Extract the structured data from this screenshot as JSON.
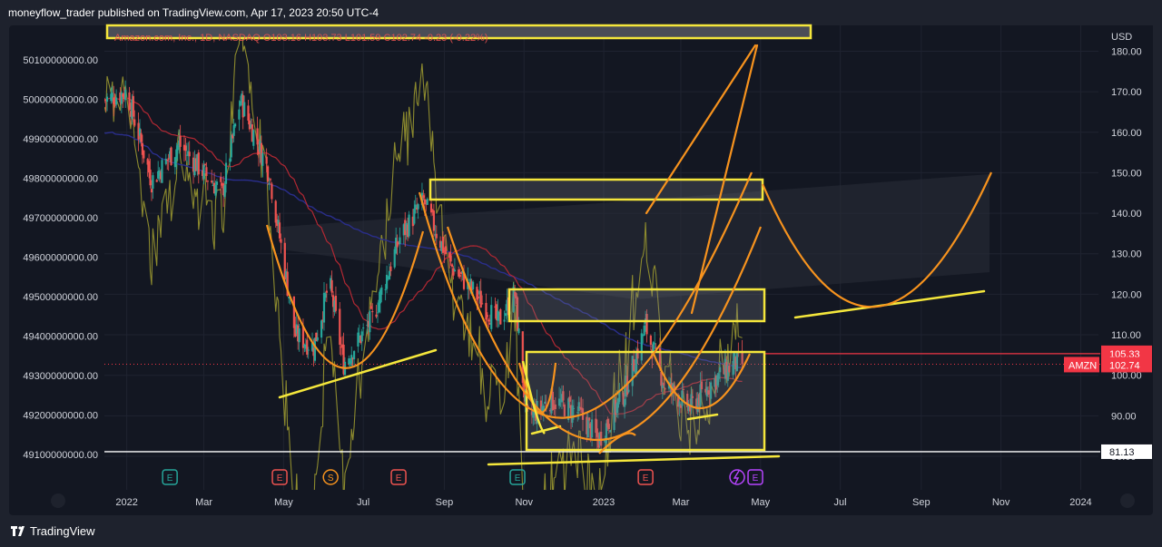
{
  "header": {
    "published": "moneyflow_trader published on TradingView.com, Apr 17, 2023 20:50 UTC-4"
  },
  "legend": {
    "text": "Amazon.com, Inc., 1D, NASDAQ O103.16 H103.73 L101.59 C102.74 -0.23 (-0.22%)"
  },
  "footer": {
    "brand": "TradingView"
  },
  "colors": {
    "background": "#131722",
    "grid": "#1f2330",
    "price_up": "#26a69a",
    "price_down": "#ef5350",
    "ma_red": "#b22833",
    "ma_blue": "#2a2e8c",
    "olive": "#8c8a2e",
    "drawing_yellow": "#f5e73c",
    "drawing_orange": "#f7931e"
  },
  "chart_data": {
    "type": "candlestick",
    "symbol": "AMZN",
    "x_ticks": [
      "2022",
      "Mar",
      "May",
      "Jul",
      "Sep",
      "Nov",
      "2023",
      "Mar",
      "May",
      "Jul",
      "Sep",
      "Nov",
      "2024"
    ],
    "y_ticks_right": [
      "180.00",
      "170.00",
      "160.00",
      "150.00",
      "140.00",
      "130.00",
      "120.00",
      "110.00",
      "100.00",
      "90.00",
      "80.00"
    ],
    "y_ticks_left": [
      "50100000000.00",
      "50000000000.00",
      "49900000000.00",
      "49800000000.00",
      "49700000000.00",
      "49600000000.00",
      "49500000000.00",
      "49400000000.00",
      "49300000000.00",
      "49200000000.00",
      "49100000000.00"
    ],
    "right_ylim": [
      80,
      181
    ],
    "left_ylim": [
      49100000000,
      50100000000
    ],
    "currency": "USD",
    "last_close": 102.74,
    "last_close_label": "102.74",
    "symbol_label": "AMZN",
    "level_red": 105.33,
    "level_red_label": "105.33",
    "level_white": 81.13,
    "level_white_label": "81.13",
    "events": [
      {
        "date": "2022-02-03",
        "type": "E"
      },
      {
        "date": "2022-04-28",
        "type": "E"
      },
      {
        "date": "2022-06-06",
        "type": "S"
      },
      {
        "date": "2022-07-28",
        "type": "E"
      },
      {
        "date": "2022-10-27",
        "type": "E"
      },
      {
        "date": "2023-02-02",
        "type": "E"
      },
      {
        "date": "2023-04-27",
        "type": "E"
      }
    ],
    "price_path_monthly": [
      {
        "date": "2021-12-15",
        "close": 168
      },
      {
        "date": "2022-01-01",
        "close": 170
      },
      {
        "date": "2022-01-20",
        "close": 148
      },
      {
        "date": "2022-02-10",
        "close": 157
      },
      {
        "date": "2022-03-01",
        "close": 150
      },
      {
        "date": "2022-03-15",
        "close": 145
      },
      {
        "date": "2022-03-29",
        "close": 168
      },
      {
        "date": "2022-04-20",
        "close": 150
      },
      {
        "date": "2022-05-10",
        "close": 110
      },
      {
        "date": "2022-05-24",
        "close": 107
      },
      {
        "date": "2022-06-05",
        "close": 123
      },
      {
        "date": "2022-06-16",
        "close": 103
      },
      {
        "date": "2022-07-08",
        "close": 114
      },
      {
        "date": "2022-07-29",
        "close": 134
      },
      {
        "date": "2022-08-16",
        "close": 143
      },
      {
        "date": "2022-09-06",
        "close": 127
      },
      {
        "date": "2022-09-20",
        "close": 122
      },
      {
        "date": "2022-10-12",
        "close": 113
      },
      {
        "date": "2022-10-25",
        "close": 120
      },
      {
        "date": "2022-11-03",
        "close": 89
      },
      {
        "date": "2022-11-21",
        "close": 94
      },
      {
        "date": "2022-12-12",
        "close": 91
      },
      {
        "date": "2022-12-28",
        "close": 84
      },
      {
        "date": "2023-01-17",
        "close": 96
      },
      {
        "date": "2023-02-02",
        "close": 112
      },
      {
        "date": "2023-02-16",
        "close": 98
      },
      {
        "date": "2023-03-08",
        "close": 92
      },
      {
        "date": "2023-03-24",
        "close": 98
      },
      {
        "date": "2023-04-11",
        "close": 103
      },
      {
        "date": "2023-04-17",
        "close": 102.74
      }
    ]
  }
}
